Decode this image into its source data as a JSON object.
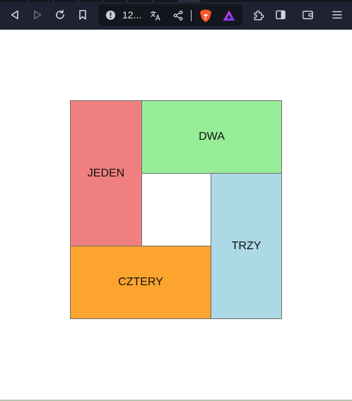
{
  "browser": {
    "url_text": "12...",
    "colors": {
      "toolbar_bg": "#1f2230",
      "urlbar_bg": "#14161d",
      "icon": "#d4d5dc",
      "icon_disabled": "#6a6c78",
      "brave_orange": "#fb542b"
    },
    "icons": {
      "back": "back-triangle-icon",
      "forward": "forward-triangle-icon",
      "reload": "reload-icon",
      "bookmark": "bookmark-icon",
      "site_info": "info-icon",
      "translate": "translate-icon",
      "share": "share-icon",
      "brave_shields": "brave-lion-icon",
      "rewards": "brave-rewards-triangle-icon",
      "extensions": "puzzle-icon",
      "sidebar": "sidebar-icon",
      "wallet": "wallet-icon",
      "menu": "hamburger-menu-icon"
    }
  },
  "page": {
    "cells": {
      "jeden": {
        "label": "JEDEN",
        "color": "#f08080"
      },
      "dwa": {
        "label": "DWA",
        "color": "#98ee98"
      },
      "trzy": {
        "label": "TRZY",
        "color": "#add8e6"
      },
      "cztery": {
        "label": "CZTERY",
        "color": "#fda42e"
      }
    }
  }
}
